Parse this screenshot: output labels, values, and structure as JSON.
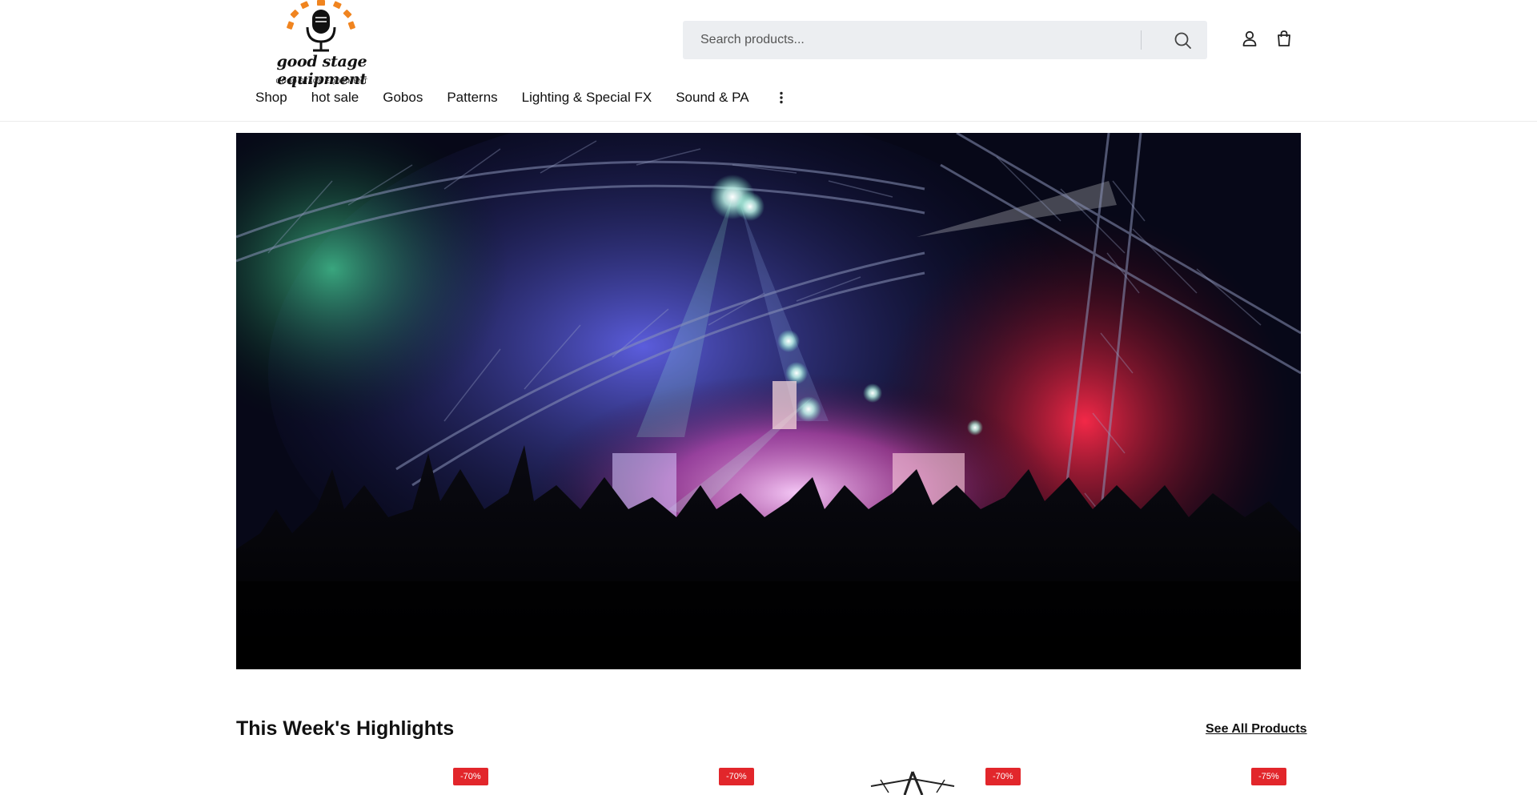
{
  "brand": {
    "name": "good stage equipment",
    "caption": "GOOD STAGE EQUIPMENT",
    "accent_color": "#f0841f"
  },
  "search": {
    "placeholder": "Search products...",
    "icon": "search-icon"
  },
  "header_icons": [
    "account-icon",
    "cart-icon"
  ],
  "nav": {
    "items": [
      {
        "label": "Shop"
      },
      {
        "label": "hot sale"
      },
      {
        "label": "Gobos"
      },
      {
        "label": "Patterns"
      },
      {
        "label": "Lighting & Special FX"
      },
      {
        "label": "Sound & PA"
      }
    ],
    "more_icon": "more-vertical-icon"
  },
  "hero": {
    "image": "concert-stage-lights-crowd"
  },
  "highlights": {
    "title": "This Week's Highlights",
    "see_all_label": "See All Products",
    "badges": [
      "-70%",
      "-70%",
      "-70%",
      "-75%"
    ],
    "badge_color": "#e2262b"
  }
}
